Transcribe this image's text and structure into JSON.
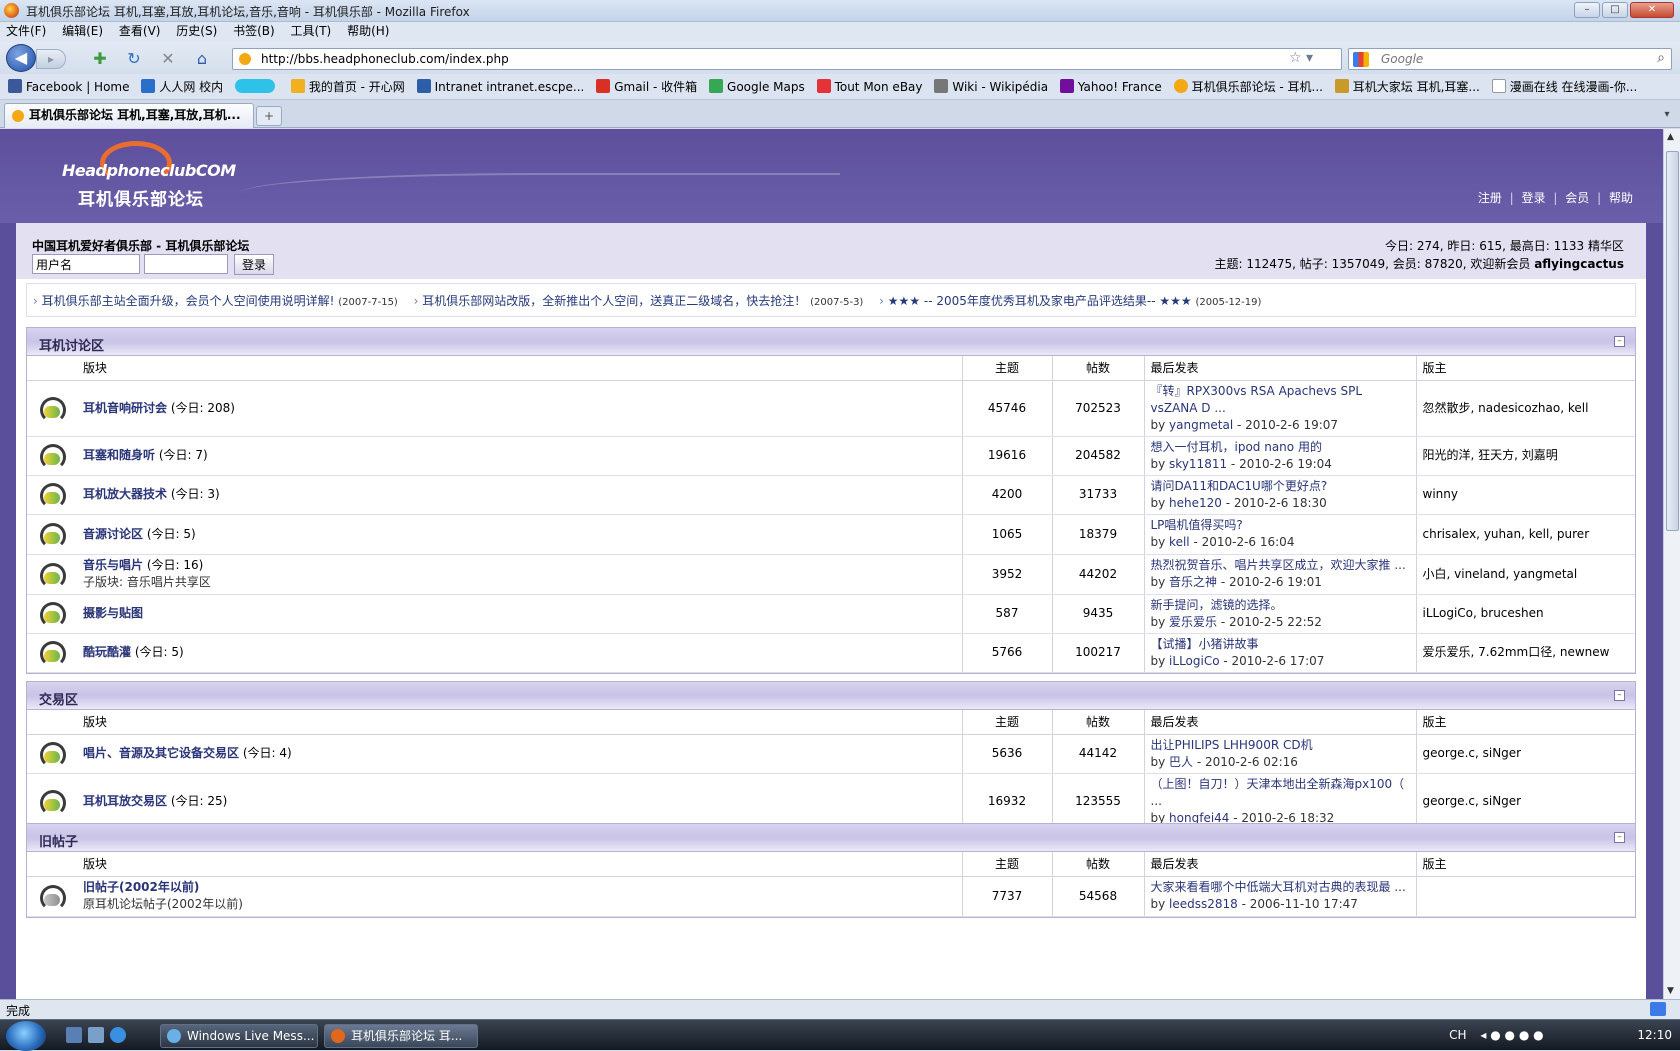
{
  "window": {
    "title": "耳机俱乐部论坛 耳机,耳塞,耳放,耳机论坛,音乐,音响 - 耳机俱乐部 - Mozilla Firefox"
  },
  "menu": [
    "文件(F)",
    "编辑(E)",
    "查看(V)",
    "历史(S)",
    "书签(B)",
    "工具(T)",
    "帮助(H)"
  ],
  "nav": {
    "url": "http://bbs.headphoneclub.com/index.php",
    "search_placeholder": "Google"
  },
  "bookmarks": [
    {
      "label": "Facebook | Home",
      "color": "#3b5998"
    },
    {
      "label": "人人网 校内",
      "color": "#2a6fc9"
    },
    {
      "label": "",
      "color": "#2ec2e8"
    },
    {
      "label": "我的首页 - 开心网",
      "color": "#f0b020"
    },
    {
      "label": "Intranet intranet.escpe...",
      "color": "#2f5ea8"
    },
    {
      "label": "Gmail - 收件箱",
      "color": "#d93025"
    },
    {
      "label": "Google Maps",
      "color": "#34a853"
    },
    {
      "label": "Tout Mon eBay",
      "color": "#e53238"
    },
    {
      "label": "Wiki - Wikipédia",
      "color": "#777777"
    },
    {
      "label": "Yahoo! France",
      "color": "#720e9e"
    },
    {
      "label": "耳机俱乐部论坛 - 耳机...",
      "color": "#f4a814"
    },
    {
      "label": "耳机大家坛 耳机,耳塞...",
      "color": "#c79a2a"
    },
    {
      "label": "漫画在线 在线漫画-你...",
      "color": "#dddddd"
    }
  ],
  "tab": {
    "label": "耳机俱乐部论坛 耳机,耳塞,耳放,耳机..."
  },
  "header": {
    "logo_en": "HeadphoneclubCOM",
    "logo_cn": "耳机俱乐部论坛",
    "links": [
      "注册",
      "登录",
      "会员",
      "帮助"
    ]
  },
  "info": {
    "site_title": "中国耳机爱好者俱乐部 - 耳机俱乐部论坛",
    "username_placeholder": "用户名",
    "login_label": "登录",
    "stats1": "今日: 274, 昨日: 615, 最高日: 1133   精华区",
    "stats2_prefix": "主题: 112475, 帖子: 1357049, 会员: 87820, 欢迎新会员 ",
    "newest_member": "aflyingcactus"
  },
  "notices": [
    {
      "text": "耳机俱乐部主站全面升级，会员个人空间使用说明详解!",
      "date": "(2007-7-15)"
    },
    {
      "text": "耳机俱乐部网站改版，全新推出个人空间，送真正二级域名，快去抢注！",
      "date": "(2007-5-3)"
    },
    {
      "text": "★★★ -- 2005年度优秀耳机及家电产品评选结果-- ★★★",
      "date": "(2005-12-19)"
    }
  ],
  "columns": {
    "forum": "版块",
    "topics": "主题",
    "posts": "帖数",
    "lastpost": "最后发表",
    "mods": "版主"
  },
  "categories": [
    {
      "title": "耳机讨论区",
      "forums": [
        {
          "name": "耳机音响研讨会",
          "today": "(今日: 208)",
          "sub": "",
          "topics": "45746",
          "posts": "702523",
          "lp_title": "『转』RPX300vs RSA Apachevs SPL vsZANA D ...",
          "lp_user": "yangmetal",
          "lp_time": " - 2010-2-6 19:07",
          "mods": "忽然散步, nadesicozhao, kell"
        },
        {
          "name": "耳塞和随身听",
          "today": "(今日: 7)",
          "sub": "",
          "topics": "19616",
          "posts": "204582",
          "lp_title": "想入一付耳机，ipod nano 用的",
          "lp_user": "sky11811",
          "lp_time": " - 2010-2-6 19:04",
          "mods": "阳光的洋, 狂天方, 刘嘉明"
        },
        {
          "name": "耳机放大器技术",
          "today": "(今日: 3)",
          "sub": "",
          "topics": "4200",
          "posts": "31733",
          "lp_title": "请问DA11和DAC1U哪个更好点?",
          "lp_user": "hehe120",
          "lp_time": " - 2010-2-6 18:30",
          "mods": "winny"
        },
        {
          "name": "音源讨论区",
          "today": "(今日: 5)",
          "sub": "",
          "topics": "1065",
          "posts": "18379",
          "lp_title": "LP唱机值得买吗?",
          "lp_user": "kell",
          "lp_time": " - 2010-2-6 16:04",
          "mods": "chrisalex, yuhan, kell, purer"
        },
        {
          "name": "音乐与唱片",
          "today": "(今日: 16)",
          "sub": "子版块: 音乐唱片共享区",
          "topics": "3952",
          "posts": "44202",
          "lp_title": "热烈祝贺音乐、唱片共享区成立，欢迎大家推 ...",
          "lp_user": "音乐之神",
          "lp_time": " - 2010-2-6 19:01",
          "mods": "小白, vineland, yangmetal"
        },
        {
          "name": "摄影与贴图",
          "today": "",
          "sub": "",
          "topics": "587",
          "posts": "9435",
          "lp_title": "新手提问，滤镜的选择。",
          "lp_user": "爱乐爱乐",
          "lp_time": " - 2010-2-5 22:52",
          "mods": "iLLogiCo, bruceshen"
        },
        {
          "name": "酷玩酷灌",
          "today": "(今日: 5)",
          "sub": "",
          "topics": "5766",
          "posts": "100217",
          "lp_title": "【试播】小猪讲故事",
          "lp_user": "iLLogiCo",
          "lp_time": " - 2010-2-6 17:07",
          "mods": "爱乐爱乐, 7.62mm口径, newnew"
        }
      ]
    },
    {
      "title": "交易区",
      "forums": [
        {
          "name": "唱片、音源及其它设备交易区",
          "today": "(今日: 4)",
          "sub": "",
          "topics": "5636",
          "posts": "44142",
          "lp_title": "出让PHILIPS LHH900R CD机",
          "lp_user": "巴人",
          "lp_time": " - 2010-2-6 02:16",
          "mods": "george.c, siNger"
        },
        {
          "name": "耳机耳放交易区",
          "today": "(今日: 25)",
          "sub": "",
          "topics": "16932",
          "posts": "123555",
          "lp_title": "（上图！自刀！）天津本地出全新森海px100（ ...",
          "lp_user": "hongfei44",
          "lp_time": " - 2010-2-6 18:32",
          "mods": "george.c, siNger"
        }
      ]
    },
    {
      "title": "旧帖子",
      "forums": [
        {
          "name": "旧帖子(2002年以前)",
          "today": "",
          "sub": "原耳机论坛帖子(2002年以前)",
          "topics": "7737",
          "posts": "54568",
          "lp_title": "大家来看看哪个中低端大耳机对古典的表现最 ...",
          "lp_user": "leedss2818",
          "lp_time": " - 2006-11-10 17:47",
          "mods": "",
          "old": true
        }
      ]
    }
  ],
  "status": "完成",
  "taskbar": {
    "buttons": [
      "Windows Live Mess...",
      "耳机俱乐部论坛 耳..."
    ],
    "tray_lang": "CH",
    "clock": "12:10"
  }
}
